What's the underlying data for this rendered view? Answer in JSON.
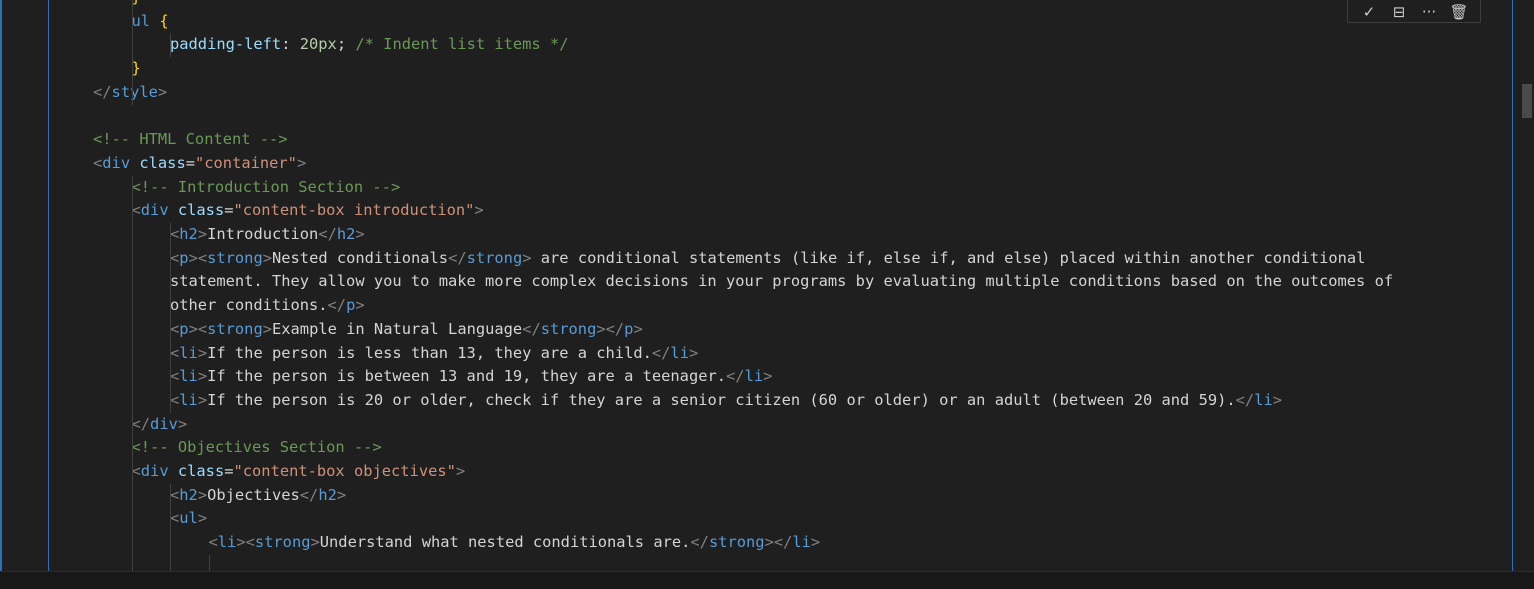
{
  "editor": {
    "lines": [
      {
        "indent": 1,
        "tokens": [
          [
            "t-brace",
            "}"
          ]
        ]
      },
      {
        "indent": 1,
        "tokens": [
          [
            "t-name",
            "ul"
          ],
          [
            "t-text",
            " "
          ],
          [
            "t-brace",
            "{"
          ]
        ]
      },
      {
        "indent": 2,
        "tokens": [
          [
            "t-prop",
            "padding-left"
          ],
          [
            "t-punc",
            ": "
          ],
          [
            "t-num",
            "20px"
          ],
          [
            "t-punc",
            "; "
          ],
          [
            "t-com",
            "/* Indent list items */"
          ]
        ]
      },
      {
        "indent": 1,
        "tokens": [
          [
            "t-brace",
            "}"
          ]
        ]
      },
      {
        "indent": 0,
        "tokens": [
          [
            "t-tag",
            "</"
          ],
          [
            "t-name",
            "style"
          ],
          [
            "t-tag",
            ">"
          ]
        ]
      },
      {
        "indent": 0,
        "tokens": []
      },
      {
        "indent": 0,
        "tokens": [
          [
            "t-com",
            "<!-- HTML Content -->"
          ]
        ]
      },
      {
        "indent": 0,
        "tokens": [
          [
            "t-tag",
            "<"
          ],
          [
            "t-name",
            "div"
          ],
          [
            "t-text",
            " "
          ],
          [
            "t-attr",
            "class"
          ],
          [
            "t-punc",
            "="
          ],
          [
            "t-str",
            "\"container\""
          ],
          [
            "t-tag",
            ">"
          ]
        ]
      },
      {
        "indent": 1,
        "tokens": [
          [
            "t-com",
            "<!-- Introduction Section -->"
          ]
        ]
      },
      {
        "indent": 1,
        "tokens": [
          [
            "t-tag",
            "<"
          ],
          [
            "t-name",
            "div"
          ],
          [
            "t-text",
            " "
          ],
          [
            "t-attr",
            "class"
          ],
          [
            "t-punc",
            "="
          ],
          [
            "t-str",
            "\"content-box introduction\""
          ],
          [
            "t-tag",
            ">"
          ]
        ]
      },
      {
        "indent": 2,
        "tokens": [
          [
            "t-tag",
            "<"
          ],
          [
            "t-name",
            "h2"
          ],
          [
            "t-tag",
            ">"
          ],
          [
            "t-text",
            "Introduction"
          ],
          [
            "t-tag",
            "</"
          ],
          [
            "t-name",
            "h2"
          ],
          [
            "t-tag",
            ">"
          ]
        ]
      },
      {
        "indent": 2,
        "tokens": [
          [
            "t-tag",
            "<"
          ],
          [
            "t-name",
            "p"
          ],
          [
            "t-tag",
            "><"
          ],
          [
            "t-name",
            "strong"
          ],
          [
            "t-tag",
            ">"
          ],
          [
            "t-text",
            "Nested conditionals"
          ],
          [
            "t-tag",
            "</"
          ],
          [
            "t-name",
            "strong"
          ],
          [
            "t-tag",
            ">"
          ],
          [
            "t-text",
            " are conditional statements (like if, else if, and else) placed within another conditional"
          ]
        ]
      },
      {
        "indent": 2,
        "tokens": [
          [
            "t-text",
            "statement. They allow you to make more complex decisions in your programs by evaluating multiple conditions based on the outcomes of"
          ]
        ]
      },
      {
        "indent": 2,
        "tokens": [
          [
            "t-text",
            "other conditions."
          ],
          [
            "t-tag",
            "</"
          ],
          [
            "t-name",
            "p"
          ],
          [
            "t-tag",
            ">"
          ]
        ]
      },
      {
        "indent": 2,
        "tokens": [
          [
            "t-tag",
            "<"
          ],
          [
            "t-name",
            "p"
          ],
          [
            "t-tag",
            "><"
          ],
          [
            "t-name",
            "strong"
          ],
          [
            "t-tag",
            ">"
          ],
          [
            "t-text",
            "Example in Natural Language"
          ],
          [
            "t-tag",
            "</"
          ],
          [
            "t-name",
            "strong"
          ],
          [
            "t-tag",
            "></"
          ],
          [
            "t-name",
            "p"
          ],
          [
            "t-tag",
            ">"
          ]
        ]
      },
      {
        "indent": 2,
        "tokens": [
          [
            "t-tag",
            "<"
          ],
          [
            "t-name",
            "li"
          ],
          [
            "t-tag",
            ">"
          ],
          [
            "t-text",
            "If the person is less than 13, they are a child."
          ],
          [
            "t-tag",
            "</"
          ],
          [
            "t-name",
            "li"
          ],
          [
            "t-tag",
            ">"
          ]
        ]
      },
      {
        "indent": 2,
        "tokens": [
          [
            "t-tag",
            "<"
          ],
          [
            "t-name",
            "li"
          ],
          [
            "t-tag",
            ">"
          ],
          [
            "t-text",
            "If the person is between 13 and 19, they are a teenager."
          ],
          [
            "t-tag",
            "</"
          ],
          [
            "t-name",
            "li"
          ],
          [
            "t-tag",
            ">"
          ]
        ]
      },
      {
        "indent": 2,
        "tokens": [
          [
            "t-tag",
            "<"
          ],
          [
            "t-name",
            "li"
          ],
          [
            "t-tag",
            ">"
          ],
          [
            "t-text",
            "If the person is 20 or older, check if they are a senior citizen (60 or older) or an adult (between 20 and 59)."
          ],
          [
            "t-tag",
            "</"
          ],
          [
            "t-name",
            "li"
          ],
          [
            "t-tag",
            ">"
          ]
        ]
      },
      {
        "indent": 1,
        "tokens": [
          [
            "t-tag",
            "</"
          ],
          [
            "t-name",
            "div"
          ],
          [
            "t-tag",
            ">"
          ]
        ]
      },
      {
        "indent": 1,
        "tokens": [
          [
            "t-com",
            "<!-- Objectives Section -->"
          ]
        ]
      },
      {
        "indent": 1,
        "tokens": [
          [
            "t-tag",
            "<"
          ],
          [
            "t-name",
            "div"
          ],
          [
            "t-text",
            " "
          ],
          [
            "t-attr",
            "class"
          ],
          [
            "t-punc",
            "="
          ],
          [
            "t-str",
            "\"content-box objectives\""
          ],
          [
            "t-tag",
            ">"
          ]
        ]
      },
      {
        "indent": 2,
        "tokens": [
          [
            "t-tag",
            "<"
          ],
          [
            "t-name",
            "h2"
          ],
          [
            "t-tag",
            ">"
          ],
          [
            "t-text",
            "Objectives"
          ],
          [
            "t-tag",
            "</"
          ],
          [
            "t-name",
            "h2"
          ],
          [
            "t-tag",
            ">"
          ]
        ]
      },
      {
        "indent": 2,
        "tokens": [
          [
            "t-tag",
            "<"
          ],
          [
            "t-name",
            "ul"
          ],
          [
            "t-tag",
            ">"
          ]
        ]
      },
      {
        "indent": 3,
        "tokens": [
          [
            "t-tag",
            "<"
          ],
          [
            "t-name",
            "li"
          ],
          [
            "t-tag",
            "><"
          ],
          [
            "t-name",
            "strong"
          ],
          [
            "t-tag",
            ">"
          ],
          [
            "t-text",
            "Understand what nested conditionals are."
          ],
          [
            "t-tag",
            "</"
          ],
          [
            "t-name",
            "strong"
          ],
          [
            "t-tag",
            "></"
          ],
          [
            "t-name",
            "li"
          ],
          [
            "t-tag",
            ">"
          ]
        ]
      }
    ]
  },
  "cell_toolbar": {
    "execute_icon": "check-icon",
    "split_icon": "split-cell-icon",
    "more_icon": "ellipsis-icon",
    "delete_icon": "trash-icon",
    "execute_glyph": "✓",
    "split_glyph": "⊟",
    "more_glyph": "···",
    "delete_glyph": "🗑"
  },
  "colors": {
    "background": "#1f1f1f",
    "cell_border": "#2f6fb5",
    "comment": "#6a9955",
    "tag_name": "#569cd6",
    "string": "#ce9178",
    "attribute": "#9cdcfe",
    "brace": "#ffd700"
  }
}
